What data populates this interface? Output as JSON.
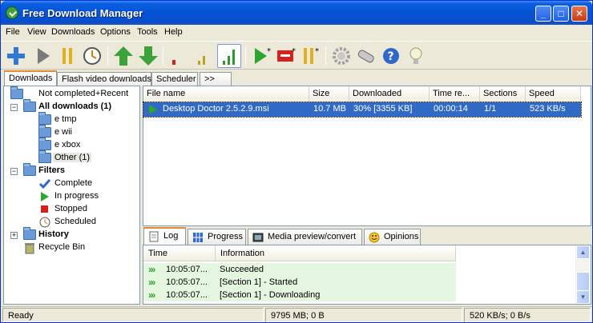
{
  "window": {
    "title": "Free Download Manager",
    "minimize": "_",
    "maximize": "□",
    "close": "✕"
  },
  "menu": [
    "File",
    "View",
    "Downloads",
    "Options",
    "Tools",
    "Help"
  ],
  "toolbar": {
    "buttons": [
      "add-icon",
      "start-icon",
      "pause-icon",
      "scheduler-clock-icon",
      "move-up-icon",
      "move-down-icon",
      "speed-low-icon",
      "speed-medium-icon",
      "speed-high-icon",
      "start-all-icon",
      "stop-all-icon",
      "pause-all-icon",
      "settings-gear-icon",
      "skins-icon",
      "help-icon",
      "tips-bulb-icon"
    ]
  },
  "tabs": {
    "items": [
      "Downloads",
      "Flash video downloads",
      "Scheduler",
      ">>"
    ],
    "selected": 0
  },
  "tree": {
    "not_completed": "Not completed+Recent",
    "all_downloads": "All downloads (1)",
    "folders": [
      "e tmp",
      "e wii",
      "e xbox",
      "Other (1)"
    ],
    "filters": "Filters",
    "filter_items": [
      "Complete",
      "In progress",
      "Stopped",
      "Scheduled"
    ],
    "history": "History",
    "recycle": "Recycle Bin"
  },
  "downloads": {
    "columns": [
      "File name",
      "Size",
      "Downloaded",
      "Time re...",
      "Sections",
      "Speed"
    ],
    "rows": [
      {
        "name": "Desktop Doctor 2.5.2.9.msi",
        "size": "10.7 MB",
        "downloaded": "30% [3355 KB]",
        "time": "00:00:14",
        "sections": "1/1",
        "speed": "523 KB/s"
      }
    ]
  },
  "lower_tabs": {
    "items": [
      "Log",
      "Progress",
      "Media preview/convert",
      "Opinions"
    ],
    "selected": 0
  },
  "log": {
    "columns": [
      "Time",
      "Information"
    ],
    "rows": [
      {
        "time": "10:05:07...",
        "info": "Succeeded"
      },
      {
        "time": "10:05:07...",
        "info": "[Section 1] - Started"
      },
      {
        "time": "10:05:07...",
        "info": "[Section 1] - Downloading"
      }
    ],
    "scroll_up": "▲",
    "scroll_down": "▼"
  },
  "status": {
    "state": "Ready",
    "disk": "9795 MB; 0 B",
    "traffic": "520 KB/s; 0 B/s"
  }
}
